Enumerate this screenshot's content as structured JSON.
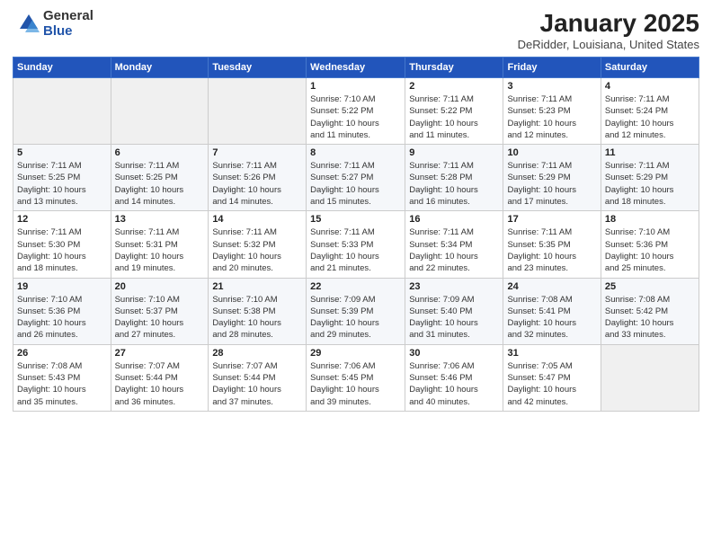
{
  "logo": {
    "general": "General",
    "blue": "Blue"
  },
  "title": {
    "month": "January 2025",
    "location": "DeRidder, Louisiana, United States"
  },
  "days_of_week": [
    "Sunday",
    "Monday",
    "Tuesday",
    "Wednesday",
    "Thursday",
    "Friday",
    "Saturday"
  ],
  "weeks": [
    [
      {
        "day": "",
        "content": ""
      },
      {
        "day": "",
        "content": ""
      },
      {
        "day": "",
        "content": ""
      },
      {
        "day": "1",
        "content": "Sunrise: 7:10 AM\nSunset: 5:22 PM\nDaylight: 10 hours\nand 11 minutes."
      },
      {
        "day": "2",
        "content": "Sunrise: 7:11 AM\nSunset: 5:22 PM\nDaylight: 10 hours\nand 11 minutes."
      },
      {
        "day": "3",
        "content": "Sunrise: 7:11 AM\nSunset: 5:23 PM\nDaylight: 10 hours\nand 12 minutes."
      },
      {
        "day": "4",
        "content": "Sunrise: 7:11 AM\nSunset: 5:24 PM\nDaylight: 10 hours\nand 12 minutes."
      }
    ],
    [
      {
        "day": "5",
        "content": "Sunrise: 7:11 AM\nSunset: 5:25 PM\nDaylight: 10 hours\nand 13 minutes."
      },
      {
        "day": "6",
        "content": "Sunrise: 7:11 AM\nSunset: 5:25 PM\nDaylight: 10 hours\nand 14 minutes."
      },
      {
        "day": "7",
        "content": "Sunrise: 7:11 AM\nSunset: 5:26 PM\nDaylight: 10 hours\nand 14 minutes."
      },
      {
        "day": "8",
        "content": "Sunrise: 7:11 AM\nSunset: 5:27 PM\nDaylight: 10 hours\nand 15 minutes."
      },
      {
        "day": "9",
        "content": "Sunrise: 7:11 AM\nSunset: 5:28 PM\nDaylight: 10 hours\nand 16 minutes."
      },
      {
        "day": "10",
        "content": "Sunrise: 7:11 AM\nSunset: 5:29 PM\nDaylight: 10 hours\nand 17 minutes."
      },
      {
        "day": "11",
        "content": "Sunrise: 7:11 AM\nSunset: 5:29 PM\nDaylight: 10 hours\nand 18 minutes."
      }
    ],
    [
      {
        "day": "12",
        "content": "Sunrise: 7:11 AM\nSunset: 5:30 PM\nDaylight: 10 hours\nand 18 minutes."
      },
      {
        "day": "13",
        "content": "Sunrise: 7:11 AM\nSunset: 5:31 PM\nDaylight: 10 hours\nand 19 minutes."
      },
      {
        "day": "14",
        "content": "Sunrise: 7:11 AM\nSunset: 5:32 PM\nDaylight: 10 hours\nand 20 minutes."
      },
      {
        "day": "15",
        "content": "Sunrise: 7:11 AM\nSunset: 5:33 PM\nDaylight: 10 hours\nand 21 minutes."
      },
      {
        "day": "16",
        "content": "Sunrise: 7:11 AM\nSunset: 5:34 PM\nDaylight: 10 hours\nand 22 minutes."
      },
      {
        "day": "17",
        "content": "Sunrise: 7:11 AM\nSunset: 5:35 PM\nDaylight: 10 hours\nand 23 minutes."
      },
      {
        "day": "18",
        "content": "Sunrise: 7:10 AM\nSunset: 5:36 PM\nDaylight: 10 hours\nand 25 minutes."
      }
    ],
    [
      {
        "day": "19",
        "content": "Sunrise: 7:10 AM\nSunset: 5:36 PM\nDaylight: 10 hours\nand 26 minutes."
      },
      {
        "day": "20",
        "content": "Sunrise: 7:10 AM\nSunset: 5:37 PM\nDaylight: 10 hours\nand 27 minutes."
      },
      {
        "day": "21",
        "content": "Sunrise: 7:10 AM\nSunset: 5:38 PM\nDaylight: 10 hours\nand 28 minutes."
      },
      {
        "day": "22",
        "content": "Sunrise: 7:09 AM\nSunset: 5:39 PM\nDaylight: 10 hours\nand 29 minutes."
      },
      {
        "day": "23",
        "content": "Sunrise: 7:09 AM\nSunset: 5:40 PM\nDaylight: 10 hours\nand 31 minutes."
      },
      {
        "day": "24",
        "content": "Sunrise: 7:08 AM\nSunset: 5:41 PM\nDaylight: 10 hours\nand 32 minutes."
      },
      {
        "day": "25",
        "content": "Sunrise: 7:08 AM\nSunset: 5:42 PM\nDaylight: 10 hours\nand 33 minutes."
      }
    ],
    [
      {
        "day": "26",
        "content": "Sunrise: 7:08 AM\nSunset: 5:43 PM\nDaylight: 10 hours\nand 35 minutes."
      },
      {
        "day": "27",
        "content": "Sunrise: 7:07 AM\nSunset: 5:44 PM\nDaylight: 10 hours\nand 36 minutes."
      },
      {
        "day": "28",
        "content": "Sunrise: 7:07 AM\nSunset: 5:44 PM\nDaylight: 10 hours\nand 37 minutes."
      },
      {
        "day": "29",
        "content": "Sunrise: 7:06 AM\nSunset: 5:45 PM\nDaylight: 10 hours\nand 39 minutes."
      },
      {
        "day": "30",
        "content": "Sunrise: 7:06 AM\nSunset: 5:46 PM\nDaylight: 10 hours\nand 40 minutes."
      },
      {
        "day": "31",
        "content": "Sunrise: 7:05 AM\nSunset: 5:47 PM\nDaylight: 10 hours\nand 42 minutes."
      },
      {
        "day": "",
        "content": ""
      }
    ]
  ]
}
